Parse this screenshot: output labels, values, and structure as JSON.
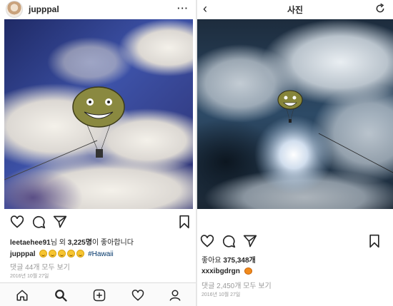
{
  "left_post": {
    "username": "jupppal",
    "more_label": "···",
    "likes_user": "leetaehee91",
    "likes_suffix": "님 외 ",
    "likes_count": "3,225명",
    "likes_tail": "이 좋아합니다",
    "caption_user": "jupppal",
    "emoji_count": 5,
    "hashtag": "#Hawaii",
    "comments_label": "댓글 44개 모두 보기",
    "date": "2016년 10월 27일"
  },
  "right_post": {
    "title": "사진",
    "back_label": "‹",
    "likes_prefix": "좋아요 ",
    "likes_count": "375,348개",
    "caption_user": "xxxibgdrgn",
    "comments_label": "댓글 2,450개 모두 보기",
    "date": "2016년 10월 27일"
  },
  "icons": {
    "left_actions": [
      "heart-icon",
      "comment-icon",
      "share-icon",
      "bookmark-icon"
    ],
    "right_actions": [
      "heart-icon",
      "comment-icon",
      "share-icon",
      "bookmark-icon"
    ],
    "bottom_nav": [
      "home-icon",
      "search-icon",
      "add-icon",
      "activity-icon",
      "profile-icon"
    ],
    "header": [
      "avatar",
      "more-icon",
      "back-icon",
      "refresh-icon"
    ]
  },
  "colors": {
    "text": "#262626",
    "muted": "#999999",
    "hashtag": "#003569",
    "left_sky": "#3b4ea2",
    "right_sky": "#26384d",
    "parachute": "#8b8a3a"
  }
}
